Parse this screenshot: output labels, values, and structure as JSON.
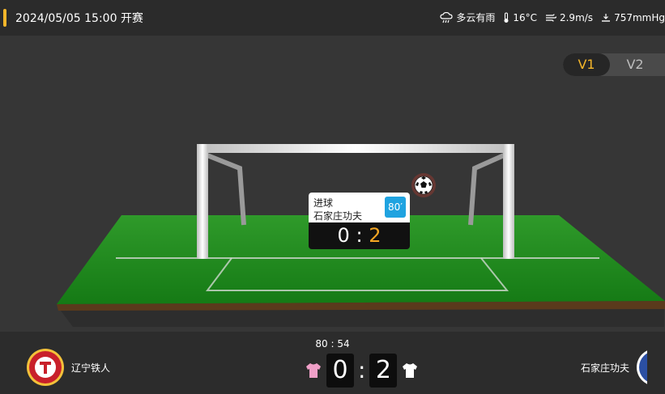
{
  "header": {
    "kickoff": "2024/05/05 15:00 开赛",
    "weather": {
      "condition": "多云有雨",
      "temperature": "16°C",
      "wind": "2.9m/s",
      "pressure": "757mmHg"
    }
  },
  "view_toggle": {
    "options": [
      "V1",
      "V2"
    ],
    "selected": "V1"
  },
  "event": {
    "type": "进球",
    "team": "石家庄功夫",
    "minute": "80′",
    "score_home": "0",
    "score_away": "2"
  },
  "match": {
    "clock": "80 : 54",
    "home_team": "辽宁铁人",
    "away_team": "石家庄功夫",
    "home_score": "0",
    "away_score": "2",
    "home_kit_color": "#f0a0c8",
    "away_kit_color": "#ffffff"
  },
  "colors": {
    "accent": "#f5b62a",
    "minute_badge": "#1fa3e0",
    "pitch": "#1f8a1f"
  },
  "icons": [
    "rain-cloud-icon",
    "thermometer-icon",
    "wind-icon",
    "pressure-icon",
    "football-icon"
  ]
}
